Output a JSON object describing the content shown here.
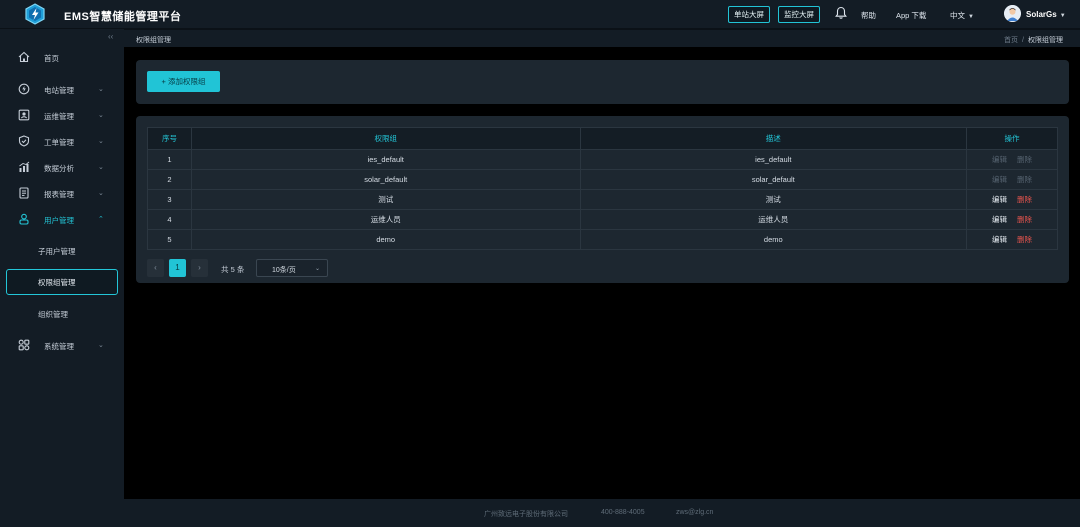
{
  "header": {
    "app_title": "EMS智慧储能管理平台",
    "btn_station_screen": "单站大屏",
    "btn_monitor_screen": "监控大屏",
    "help": "帮助",
    "app_download": "App 下载",
    "language": "中文",
    "user_name": "SolarGs",
    "logo_icon": "bolt-hexagon-icon",
    "accent_color": "#21c4d6"
  },
  "sidebar": {
    "collapse_glyph": "‹‹",
    "items": [
      {
        "label": "首页",
        "icon": "home-icon"
      },
      {
        "label": "电站管理",
        "icon": "station-icon"
      },
      {
        "label": "运维管理",
        "icon": "maintenance-icon"
      },
      {
        "label": "工单管理",
        "icon": "shield-icon"
      },
      {
        "label": "数据分析",
        "icon": "chart-icon"
      },
      {
        "label": "报表管理",
        "icon": "report-icon"
      },
      {
        "label": "用户管理",
        "icon": "user-icon"
      },
      {
        "label": "系统管理",
        "icon": "apps-icon"
      }
    ],
    "sub_items": [
      {
        "label": "子用户管理"
      },
      {
        "label": "权限组管理"
      },
      {
        "label": "组织管理"
      }
    ]
  },
  "breadcrumb": {
    "page_title": "权限组管理",
    "home": "首页",
    "separator": "/",
    "current": "权限组管理"
  },
  "toolbar": {
    "add_label": "+ 添加权限组"
  },
  "table": {
    "columns": [
      "序号",
      "权限组",
      "描述",
      "操作"
    ],
    "edit_label": "编辑",
    "delete_label": "删除",
    "rows": [
      {
        "no": "1",
        "group": "ies_default",
        "desc": "ies_default"
      },
      {
        "no": "2",
        "group": "solar_default",
        "desc": "solar_default"
      },
      {
        "no": "3",
        "group": "测试",
        "desc": "测试"
      },
      {
        "no": "4",
        "group": "运维人员",
        "desc": "运维人员"
      },
      {
        "no": "5",
        "group": "demo",
        "desc": "demo"
      }
    ]
  },
  "pagination": {
    "prev": "‹",
    "current_page": "1",
    "next": "›",
    "total_text": "共 5 条",
    "page_size": "10条/页"
  },
  "footer": {
    "company": "广州致远电子股份有限公司",
    "phone": "400-888-4005",
    "email": "zws@zlg.cn"
  }
}
